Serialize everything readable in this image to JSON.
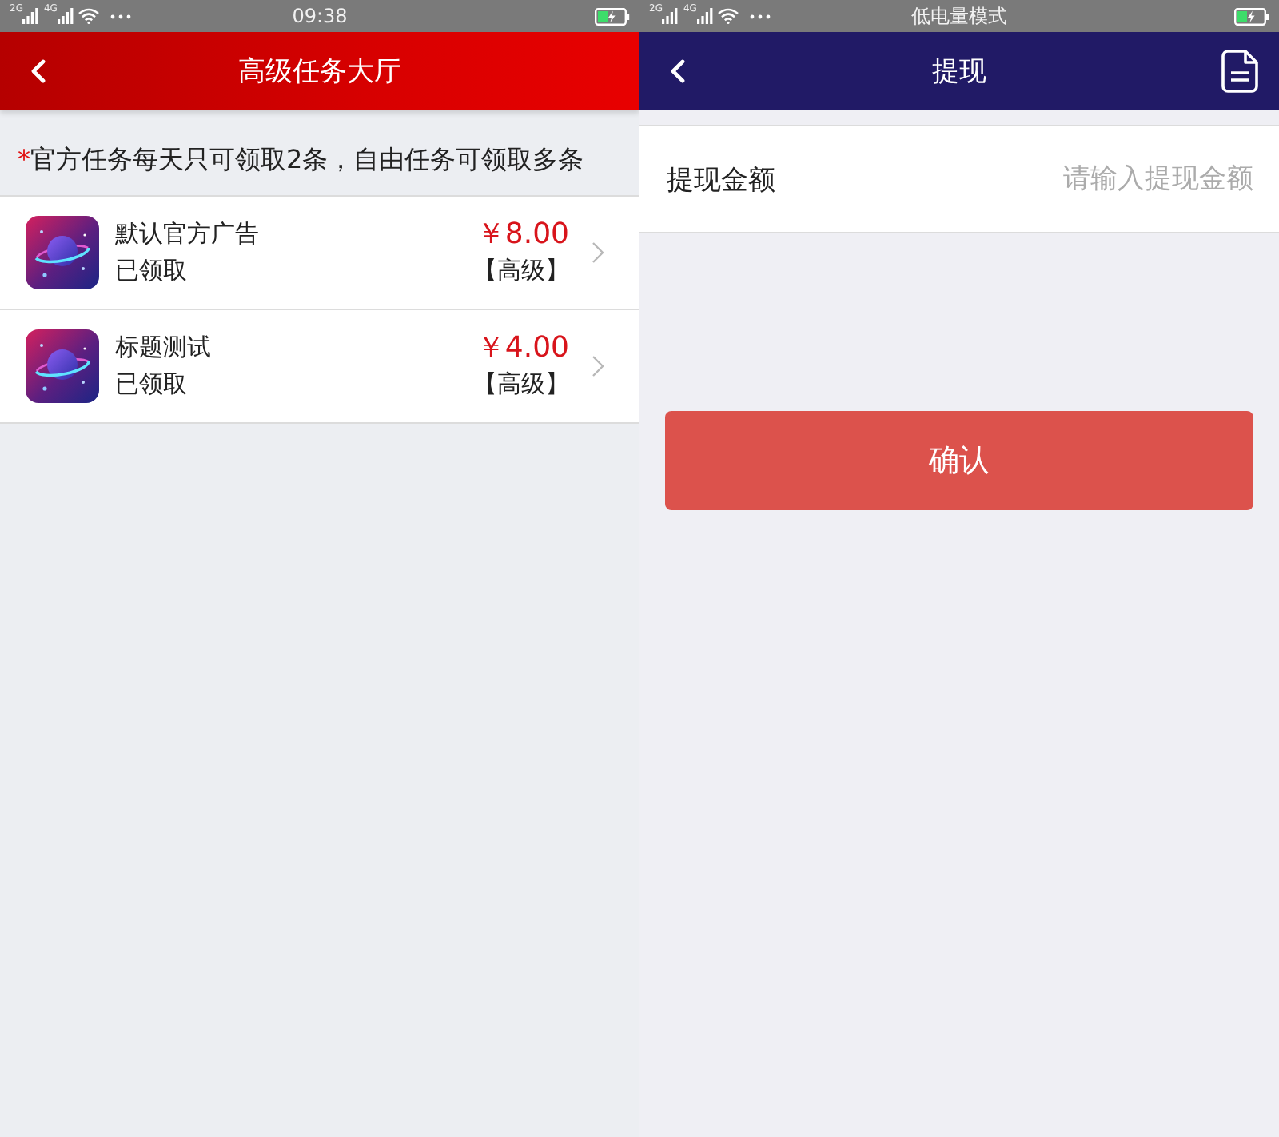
{
  "screens": [
    {
      "kind": "task_hall",
      "status_bar": {
        "networks": [
          "2G",
          "4G"
        ],
        "time": "09:38"
      },
      "nav_bar": {
        "title": "高级任务大厅"
      },
      "notice": {
        "mark": "*",
        "text": "官方任务每天只可领取2条，自由任务可领取多条"
      },
      "tasks": [
        {
          "title": "默认官方广告",
          "status": "已领取",
          "price": "￥8.00",
          "tag": "【高级】"
        },
        {
          "title": "标题测试",
          "status": "已领取",
          "price": "￥4.00",
          "tag": "【高级】"
        }
      ]
    },
    {
      "kind": "withdraw",
      "status_bar": {
        "networks": [
          "2G",
          "4G"
        ],
        "mode_notice": "低电量模式"
      },
      "nav_bar": {
        "title": "提现"
      },
      "amount_field": {
        "label": "提现金额",
        "placeholder": "请输入提现金额"
      },
      "confirm_button": "确认"
    }
  ]
}
